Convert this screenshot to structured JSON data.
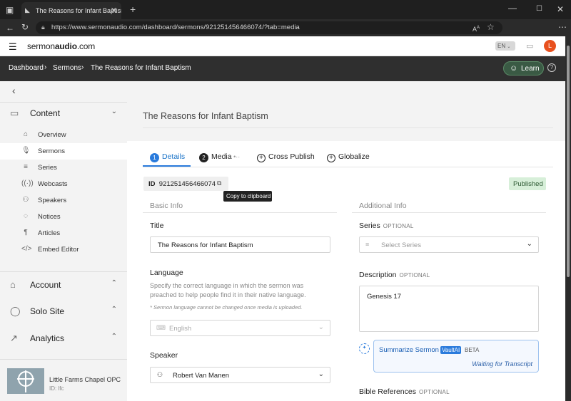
{
  "browser": {
    "tab_title": "The Reasons for Infant Baptism | S",
    "url": "https://www.sermonaudio.com/dashboard/sermons/921251456466074/?tab=media"
  },
  "site": {
    "logo_pre": "sermon",
    "logo_bold": "audio",
    "logo_post": ".com",
    "language": "EN",
    "avatar_letter": "L"
  },
  "breadcrumb": [
    "Dashboard",
    "Sermons",
    "The Reasons for Infant Baptism"
  ],
  "learn_label": "Learn",
  "sidebar": {
    "content_label": "Content",
    "items": [
      {
        "label": "Overview",
        "icon": "home-icon"
      },
      {
        "label": "Sermons",
        "icon": "mic-icon"
      },
      {
        "label": "Series",
        "icon": "list-icon"
      },
      {
        "label": "Webcasts",
        "icon": "broadcast-icon"
      },
      {
        "label": "Speakers",
        "icon": "people-icon"
      },
      {
        "label": "Notices",
        "icon": "chat-icon"
      },
      {
        "label": "Articles",
        "icon": "paragraph-icon"
      },
      {
        "label": "Embed Editor",
        "icon": "code-icon"
      }
    ],
    "account_label": "Account",
    "solo_site_label": "Solo Site",
    "analytics_label": "Analytics",
    "church_name": "Little Farms Chapel OPC",
    "church_id": "ID: lfc"
  },
  "page": {
    "title": "The Reasons for Infant Baptism",
    "tabs": [
      {
        "num": "1",
        "label": "Details"
      },
      {
        "num": "2",
        "label": "Media"
      },
      {
        "label": "Cross Publish"
      },
      {
        "label": "Globalize"
      }
    ],
    "id_label": "ID",
    "id_value": "921251456466074",
    "tooltip": "Copy to clipboard",
    "status": "Published",
    "basic_info": "Basic Info",
    "additional_info": "Additional Info",
    "title_label": "Title",
    "title_value": "The Reasons for Infant Baptism",
    "language_label": "Language",
    "language_help": "Specify the correct language in which the sermon was preached to help people find it in their native language.",
    "language_note": "* Sermon language cannot be changed once media is uploaded.",
    "language_value": "English",
    "speaker_label": "Speaker",
    "speaker_value": "Robert Van Manen",
    "series_label": "Series",
    "optional": "OPTIONAL",
    "series_placeholder": "Select Series",
    "description_label": "Description",
    "description_value": "Genesis 17",
    "summarize_label": "Summarize Sermon",
    "vault_badge": "VaultAI",
    "beta": "BETA",
    "waiting": "Waiting for Transcript",
    "bible_refs_label": "Bible References"
  }
}
